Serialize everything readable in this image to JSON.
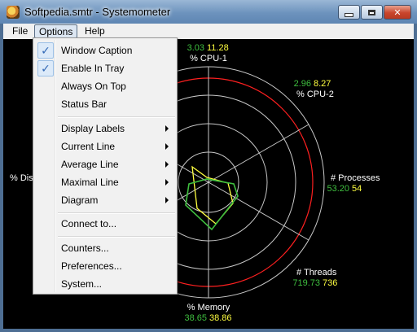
{
  "window": {
    "title": "Softpedia.smtr - Systemometer",
    "minimize_icon": "minimize-icon",
    "maximize_icon": "maximize-icon",
    "close_icon": "close-icon",
    "close_glyph": "✕"
  },
  "menubar": {
    "file": "File",
    "options": "Options",
    "help": "Help"
  },
  "options_menu": {
    "items": [
      {
        "label": "Window Caption",
        "checked": true
      },
      {
        "label": "Enable In Tray",
        "checked": true
      },
      {
        "label": "Always On Top",
        "checked": false
      },
      {
        "label": "Status Bar",
        "checked": false
      },
      {
        "label": "Display Labels",
        "submenu": true
      },
      {
        "label": "Current Line",
        "submenu": true
      },
      {
        "label": "Average Line",
        "submenu": true
      },
      {
        "label": "Maximal Line",
        "submenu": true
      },
      {
        "label": "Diagram",
        "submenu": true
      },
      {
        "label": "Connect to..."
      },
      {
        "label": "Counters..."
      },
      {
        "label": "Preferences..."
      },
      {
        "label": "System..."
      }
    ],
    "check_glyph": "✓"
  },
  "chart_data": {
    "type": "radar",
    "axes": [
      {
        "name": "% CPU-1",
        "current": "3.03",
        "max": "11.28"
      },
      {
        "name": "% CPU-2",
        "current": "2.96",
        "max": "8.27"
      },
      {
        "name": "# Processes",
        "current": "53.20",
        "max": "54"
      },
      {
        "name": "# Threads",
        "current": "719.73",
        "max": "736"
      },
      {
        "name": "% Memory",
        "current": "38.65",
        "max": "38.86"
      },
      {
        "name": "% Dis",
        "current": "",
        "max": ""
      }
    ],
    "colors": {
      "current": "#3fbf3f",
      "max": "#ffff40",
      "limit_ring": "#ff2020",
      "grid": "#c8c8c8",
      "label": "#ffffff"
    }
  }
}
